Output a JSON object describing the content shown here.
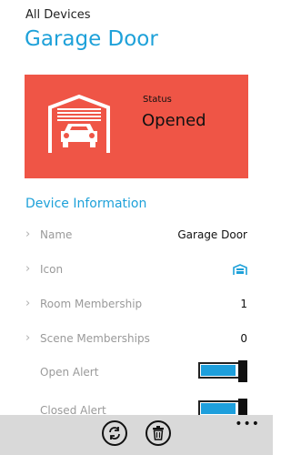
{
  "header": {
    "breadcrumb": "All Devices",
    "title": "Garage Door"
  },
  "status_card": {
    "label": "Status",
    "value": "Opened",
    "color": "#ef5546",
    "icon": "garage-car-icon"
  },
  "device_info": {
    "heading": "Device Information",
    "rows": [
      {
        "label": "Name",
        "value": "Garage Door"
      },
      {
        "label": "Icon",
        "icon": "garage-icon"
      },
      {
        "label": "Room Membership",
        "value": "1"
      },
      {
        "label": "Scene Memberships",
        "value": "0"
      }
    ],
    "toggles": [
      {
        "label": "Open Alert",
        "on": true
      },
      {
        "label": "Closed Alert",
        "on": true
      }
    ]
  },
  "app_bar": {
    "buttons": [
      {
        "name": "refresh",
        "icon": "refresh-icon"
      },
      {
        "name": "delete",
        "icon": "trash-icon"
      }
    ],
    "more_label": "•••"
  },
  "colors": {
    "accent": "#1ea1d9",
    "toggle_fill": "#1e9fdc",
    "app_bar": "#d9d9d9"
  }
}
